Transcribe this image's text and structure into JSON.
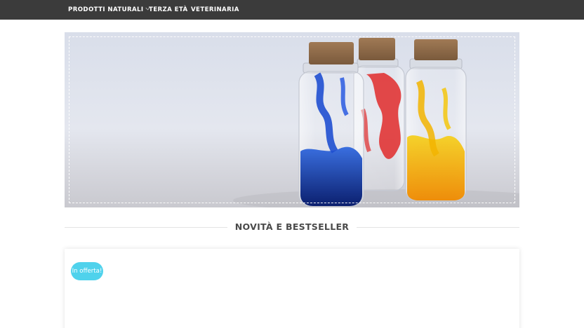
{
  "nav": {
    "items": [
      {
        "label": "PRODOTTI NATURALI",
        "has_dropdown": true,
        "icon": "chevron-down-icon"
      },
      {
        "label": "TERZA ETÀ"
      },
      {
        "label": "VETERINARIA"
      }
    ],
    "background": "#3b3b3b"
  },
  "hero": {
    "image": "glass-bottles-with-ink",
    "bottle_colors": [
      "#1f3db8",
      "#e02a2a",
      "#f2b400"
    ]
  },
  "section": {
    "title": "NOVITÀ E BESTSELLER"
  },
  "product_card": {
    "badge": "In offerta!",
    "badge_color": "#4fd2ec"
  }
}
